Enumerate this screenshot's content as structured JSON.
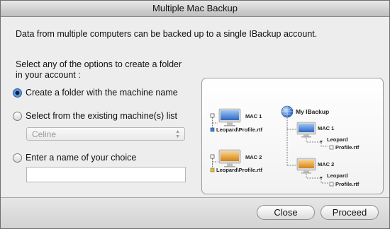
{
  "window": {
    "title": "Multiple Mac Backup"
  },
  "intro_text": "Data from multiple computers can be backed up to a single IBackup account.",
  "prompt_text": "Select any of the options to create a folder in your account :",
  "options": [
    {
      "label": "Create a folder with the machine name",
      "selected": true
    },
    {
      "label": "Select from the existing machine(s) list",
      "selected": false
    },
    {
      "label": "Enter a name of your choice",
      "selected": false
    }
  ],
  "machine_select": {
    "value": "Celine"
  },
  "custom_name": {
    "value": ""
  },
  "diagram": {
    "left": [
      {
        "machine": "MAC 1",
        "file": "Leopard\\Profile.rtf",
        "color": "#3f7fd6"
      },
      {
        "machine": "MAC 2",
        "file": "Leopard\\Profile.rtf",
        "color": "#e5a02a"
      }
    ],
    "right": {
      "account": "My IBackup",
      "machines": [
        {
          "machine": "MAC 1",
          "folder": "Leopard",
          "file": "Profile.rtf",
          "color": "#3f7fd6"
        },
        {
          "machine": "MAC 2",
          "folder": "Leopard",
          "file": "Profile.rtf",
          "color": "#e5a02a"
        }
      ]
    }
  },
  "buttons": {
    "close": "Close",
    "proceed": "Proceed"
  },
  "icons": {
    "selected_radio": "radio-selected",
    "select_arrows": "updown-arrows",
    "computer": "imac-icon",
    "account": "globe-icon"
  }
}
